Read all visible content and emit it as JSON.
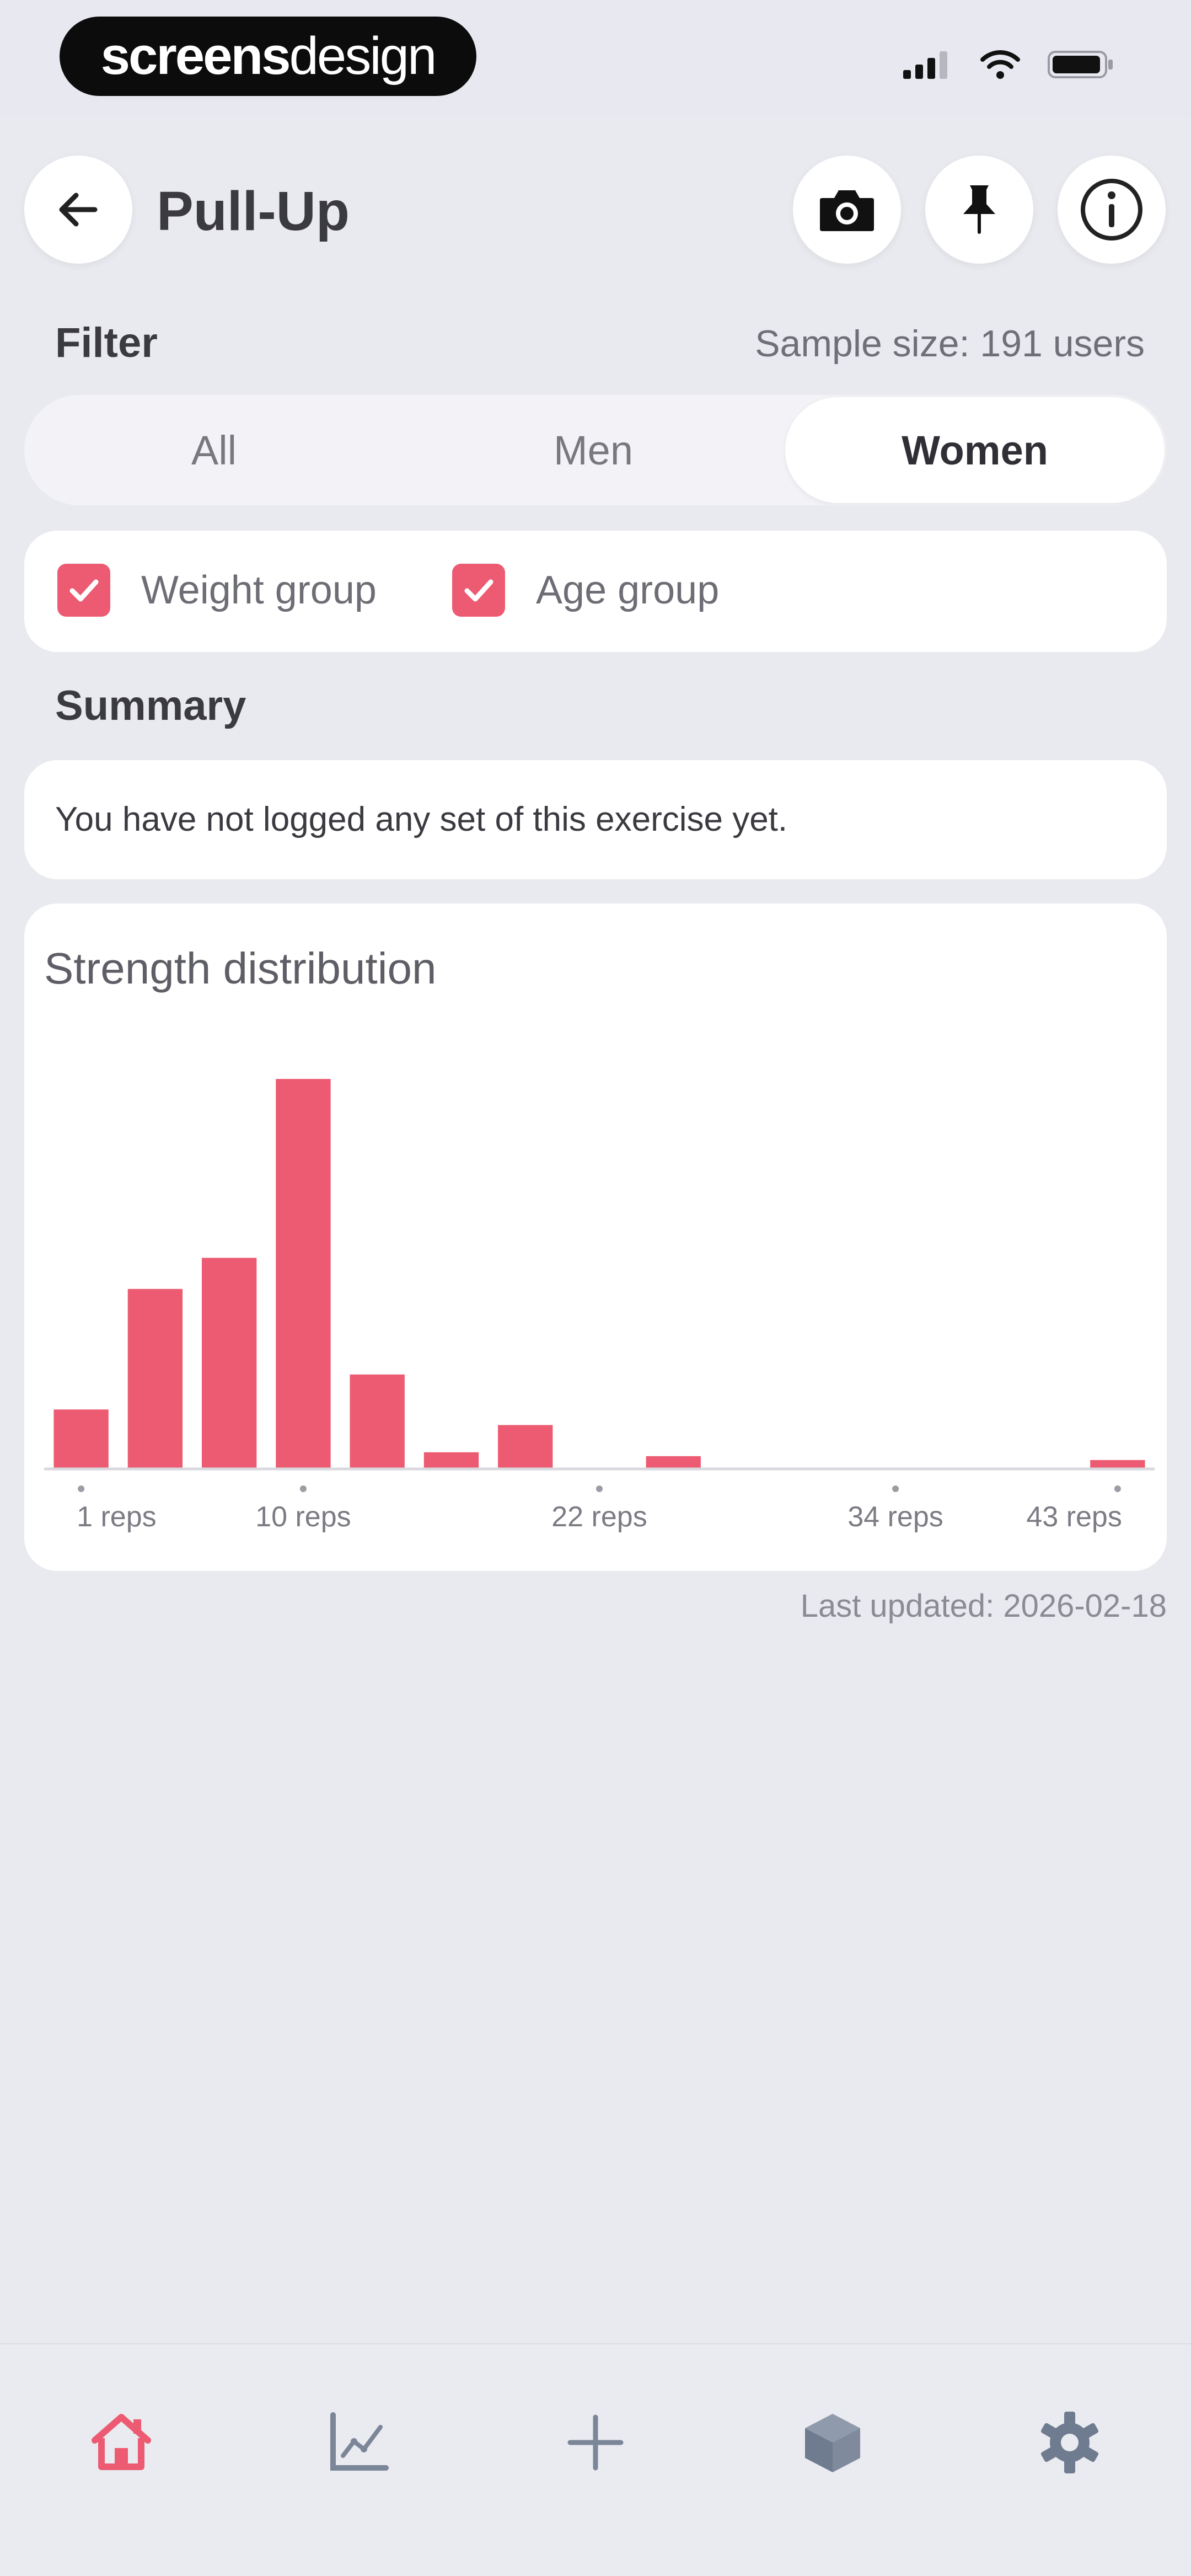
{
  "status_bar": {
    "brand_part1": "screens",
    "brand_part2": "design"
  },
  "header": {
    "title": "Pull-Up"
  },
  "filter": {
    "label": "Filter",
    "sample_size": "Sample size: 191 users",
    "tabs": [
      "All",
      "Men",
      "Women"
    ],
    "active_tab": "Women",
    "checkboxes": [
      {
        "label": "Weight group",
        "checked": true
      },
      {
        "label": "Age group",
        "checked": true
      }
    ]
  },
  "summary": {
    "label": "Summary",
    "text": "You have not logged any set of this exercise yet."
  },
  "chart": {
    "title": "Strength distribution",
    "last_updated": "Last updated: 2026-02-18"
  },
  "chart_data": {
    "type": "bar",
    "categories": [
      1,
      4,
      7,
      10,
      13,
      16,
      19,
      22,
      25,
      28,
      31,
      34,
      37,
      40,
      43
    ],
    "values": [
      15,
      46,
      54,
      100,
      24,
      4,
      11,
      0,
      3,
      0,
      0,
      0,
      0,
      0,
      2
    ],
    "x_tick_labels": [
      "1 reps",
      "10 reps",
      "22 reps",
      "34 reps",
      "43 reps"
    ],
    "x_tick_values": [
      1,
      10,
      22,
      34,
      43
    ],
    "ylim": [
      0,
      100
    ],
    "bar_color": "#ec5b72",
    "grid": false
  },
  "colors": {
    "accent": "#ec5b72",
    "background": "#e9eaef",
    "card": "#ffffff",
    "nav_inactive": "#7b8698"
  },
  "nav": {
    "items": [
      {
        "icon": "home-icon",
        "active": true
      },
      {
        "icon": "stats-chart-icon",
        "active": false
      },
      {
        "icon": "add-icon",
        "active": false
      },
      {
        "icon": "library-cube-icon",
        "active": false
      },
      {
        "icon": "settings-gear-icon",
        "active": false
      }
    ]
  }
}
